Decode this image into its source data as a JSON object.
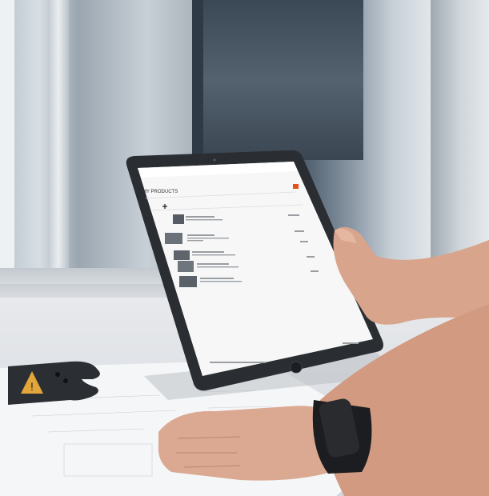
{
  "tablet_screen": {
    "page_title": "MY PRODUCTS"
  },
  "colors": {
    "accent": "#e8501b",
    "frame": "#2a2d31"
  }
}
